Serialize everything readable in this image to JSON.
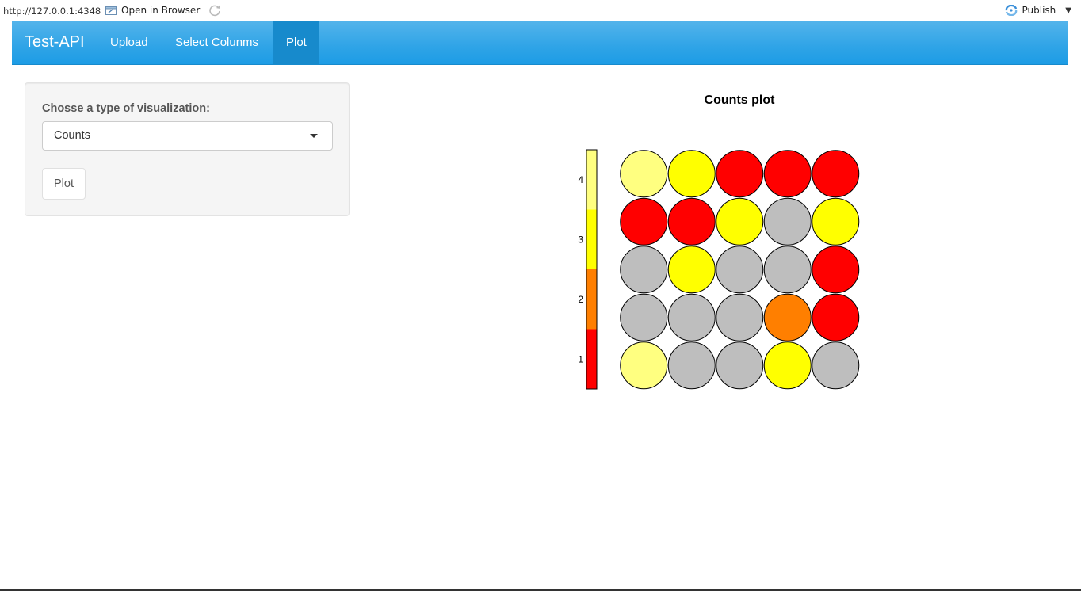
{
  "viewer": {
    "url": "http://127.0.0.1:4348",
    "open_in_browser_label": "Open in Browser",
    "publish_label": "Publish"
  },
  "navbar": {
    "brand": "Test-API",
    "tabs": [
      {
        "label": "Upload"
      },
      {
        "label": "Select Colunms"
      },
      {
        "label": "Plot",
        "active": true
      }
    ]
  },
  "sidebar": {
    "label": "Chosse a type of visualization:",
    "select_value": "Counts",
    "plot_button_label": "Plot"
  },
  "chart_data": {
    "type": "heatmap",
    "title": "Counts plot",
    "rows": 5,
    "cols": 5,
    "grid": [
      [
        "lightyellow",
        "yellow",
        "red",
        "red",
        "red"
      ],
      [
        "red",
        "red",
        "yellow",
        "gray",
        "yellow"
      ],
      [
        "gray",
        "yellow",
        "gray",
        "gray",
        "red"
      ],
      [
        "gray",
        "gray",
        "gray",
        "orange",
        "red"
      ],
      [
        "lightyellow",
        "gray",
        "gray",
        "yellow",
        "gray"
      ]
    ],
    "legend": {
      "ticks": [
        "1",
        "2",
        "3",
        "4"
      ],
      "segments": [
        {
          "label": "1",
          "color": "#ff0000"
        },
        {
          "label": "2",
          "color": "#ff7f00"
        },
        {
          "label": "3",
          "color": "#ffff00"
        },
        {
          "label": "4",
          "color": "#ffff80"
        }
      ]
    },
    "colors": {
      "lightyellow": "#ffff80",
      "yellow": "#ffff00",
      "red": "#ff0000",
      "orange": "#ff7f00",
      "gray": "#bebebe"
    }
  },
  "colors": {
    "navbar": "#2fa4e7",
    "navbar_active": "#178acc"
  }
}
